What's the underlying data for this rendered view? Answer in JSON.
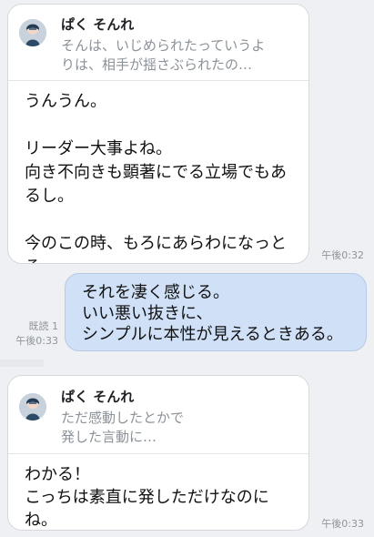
{
  "messages": [
    {
      "type": "received_quote",
      "quote_name": "ぱく そんれ",
      "quote_text": "そんは、いじめられたっていうよ\nりは、相手が揺さぶられたの…",
      "body": "うんうん。\n\nリーダー大事よね。\n向き不向きも顕著にでる立場でもあ\nるし。\n\n今のこの時、もろにあらわになっと\nる。",
      "time": "午後0:32"
    },
    {
      "type": "sent",
      "body": "それを凄く感じる。\nいい悪い抜きに、\nシンプルに本性が見えるときある。",
      "read": "既読 1",
      "time": "午後0:33"
    },
    {
      "type": "received_quote",
      "quote_name": "ぱく そんれ",
      "quote_text": "ただ感動したとかで\n発した言動に…",
      "body": "わかる！\nこっちは素直に発しただけなのに\nね。",
      "time": "午後0:33"
    }
  ],
  "colors": {
    "background": "#eef0f3",
    "received_bubble": "#ffffff",
    "sent_bubble": "#cfe0f7",
    "meta_text": "#8f949a",
    "quote_text": "#8c9299"
  },
  "icons": {
    "quote_avatar": "avatar-icon"
  }
}
